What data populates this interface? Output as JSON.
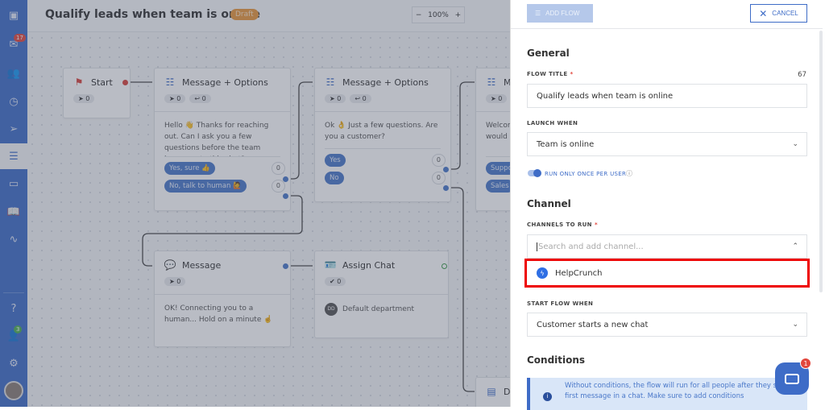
{
  "sidebar": {
    "inbox_badge": "17",
    "team_badge": "3",
    "items": [
      "logo-icon",
      "inbox-icon",
      "contacts-icon",
      "history-icon",
      "send-icon",
      "chatbot-icon",
      "knowledge-icon",
      "book-icon",
      "activity-icon",
      "help-icon",
      "team-icon",
      "settings-icon",
      "avatar"
    ]
  },
  "header": {
    "title": "Qualify leads when team is online",
    "status": "Draft",
    "zoom": "100%",
    "zoom_minus": "−",
    "zoom_plus": "+"
  },
  "nodes": {
    "start": {
      "title": "Start",
      "sent": "0"
    },
    "mo1": {
      "title": "Message + Options",
      "sent": "0",
      "replied": "0",
      "text": "Hello 👋 Thanks for reaching out. Can I ask you a few questions before the team jumps on to this chat?",
      "options": [
        {
          "label": "Yes, sure 👍",
          "count": "0"
        },
        {
          "label": "No, talk to human 🙋",
          "count": "0"
        }
      ]
    },
    "mo2": {
      "title": "Message + Options",
      "sent": "0",
      "replied": "0",
      "text": "Ok 👌 Just a few questions. Are you a customer?",
      "options": [
        {
          "label": "Yes",
          "count": "0"
        },
        {
          "label": "No",
          "count": "0"
        }
      ]
    },
    "mo3": {
      "title": "Message + Options",
      "sent": "0",
      "text": "Welcome! Which department would you like to reach out to?",
      "options": [
        {
          "label": "Support"
        },
        {
          "label": "Sales"
        }
      ]
    },
    "message": {
      "title": "Message",
      "sent": "0",
      "text": "OK! Connecting you to a human... Hold on a minute ☝️"
    },
    "assign": {
      "title": "Assign Chat",
      "done": "0",
      "department_initials": "DD",
      "department": "Default department"
    },
    "bottom": {
      "title": "D"
    }
  },
  "panel": {
    "add_flow": "ADD FLOW",
    "cancel": "CANCEL",
    "general": "General",
    "flow_title_label": "FLOW TITLE",
    "flow_title_remaining": "67",
    "flow_title_value": "Qualify leads when team is online",
    "launch_label": "LAUNCH WHEN",
    "launch_value": "Team is online",
    "run_once_label": "RUN ONLY ONCE PER USER",
    "run_once_on": true,
    "channel": "Channel",
    "channels_label": "CHANNELS TO RUN",
    "channels_placeholder": "Search and add channel...",
    "channel_option": "HelpCrunch",
    "start_label": "START FLOW WHEN",
    "start_value": "Customer starts a new chat",
    "conditions": "Conditions",
    "info": "Without conditions, the flow will run for all people after they send the first message in a chat. Make sure to add conditions",
    "chat_badge": "1"
  },
  "colors": {
    "accent": "#3e6cc7",
    "draft": "#e8963a",
    "highlight": "#e00000"
  }
}
